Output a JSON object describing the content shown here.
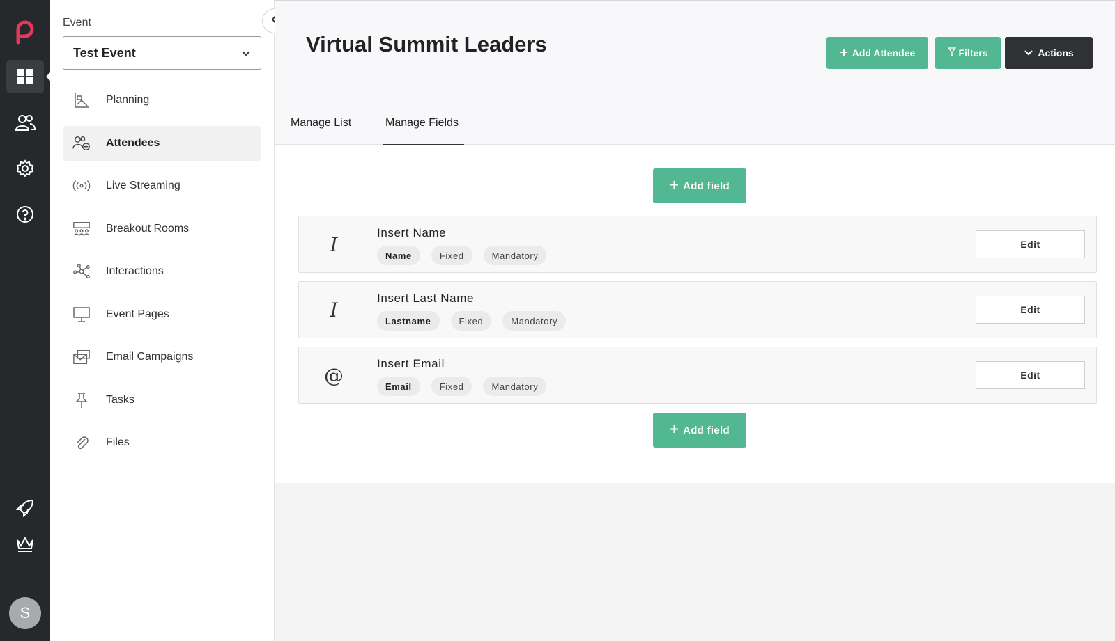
{
  "rail": {
    "icons": [
      "app-logo-icon",
      "dashboard-icon",
      "users-icon",
      "settings-icon",
      "help-icon",
      "rocket-icon",
      "crown-icon"
    ],
    "avatar_initial": "S",
    "accent": "#e8365d"
  },
  "sidebar": {
    "event_label": "Event",
    "event_select_value": "Test Event",
    "items": [
      {
        "label": "Planning",
        "icon": "planning-icon"
      },
      {
        "label": "Attendees",
        "icon": "attendees-icon",
        "active": true
      },
      {
        "label": "Live Streaming",
        "icon": "live-streaming-icon"
      },
      {
        "label": "Breakout Rooms",
        "icon": "breakout-rooms-icon"
      },
      {
        "label": "Interactions",
        "icon": "interactions-icon"
      },
      {
        "label": "Event Pages",
        "icon": "event-pages-icon"
      },
      {
        "label": "Email Campaigns",
        "icon": "email-campaigns-icon"
      },
      {
        "label": "Tasks",
        "icon": "pin-icon"
      },
      {
        "label": "Files",
        "icon": "paperclip-icon"
      }
    ]
  },
  "header": {
    "title": "Virtual Summit Leaders",
    "add_attendee": "Add Attendee",
    "filters": "Filters",
    "actions": "Actions"
  },
  "tabs": [
    {
      "label": "Manage List"
    },
    {
      "label": "Manage Fields",
      "active": true
    }
  ],
  "add_field_label": "Add field",
  "fields": [
    {
      "title": "Insert Name",
      "icon": "text-cursor-icon",
      "tags": [
        "Name",
        "Fixed",
        "Mandatory"
      ],
      "edit": "Edit"
    },
    {
      "title": "Insert Last Name",
      "icon": "text-cursor-icon",
      "tags": [
        "Lastname",
        "Fixed",
        "Mandatory"
      ],
      "edit": "Edit"
    },
    {
      "title": "Insert Email",
      "icon": "at-sign-icon",
      "tags": [
        "Email",
        "Fixed",
        "Mandatory"
      ],
      "edit": "Edit"
    }
  ],
  "colors": {
    "green": "#52b893",
    "dark": "#2f3336",
    "rail": "#26292b"
  }
}
